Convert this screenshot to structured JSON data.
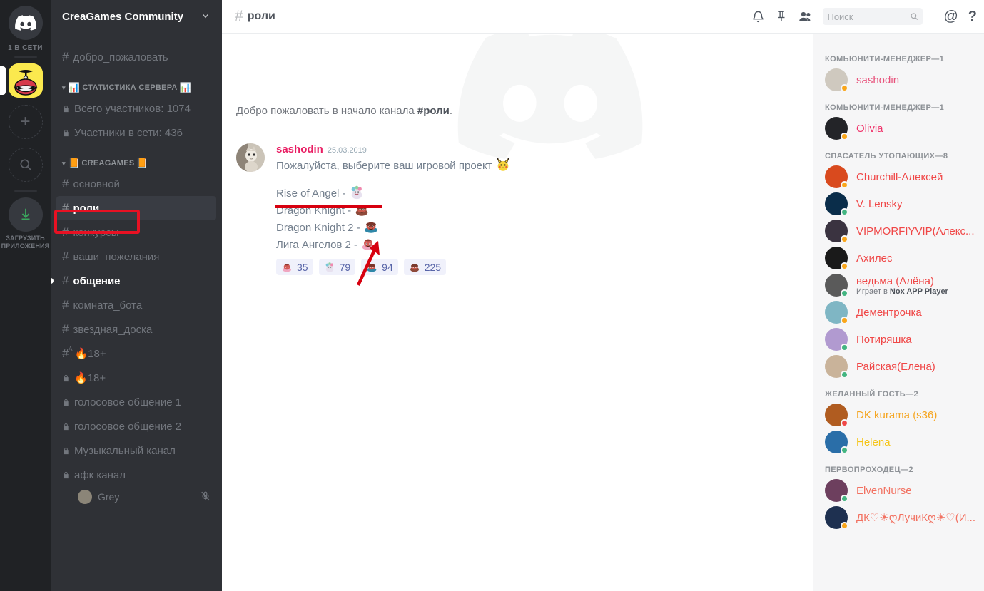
{
  "rail": {
    "online_count": "1 В СЕТИ",
    "server_name": "CreaGames",
    "add_server_label": "+",
    "explore_label": "search-icon",
    "download_label": "ЗАГРУЗИТЬ\nПРИЛОЖЕНИЯ",
    "download_line1": "ЗАГРУЗИТЬ",
    "download_line2": "ПРИЛОЖЕНИЯ"
  },
  "sidebar": {
    "guild_name": "CreaGames Community",
    "chevron": "⌄",
    "items": [
      {
        "type": "channel",
        "icon": "hash",
        "label": "добро_пожаловать",
        "state": "normal"
      },
      {
        "type": "category",
        "label": "📊 СТАТИСТИКА СЕРВЕРА 📊",
        "text": "СТАТИСТИКА СЕРВЕРА"
      },
      {
        "type": "channel",
        "icon": "lock",
        "label": "Всего участников: 1074",
        "state": "normal"
      },
      {
        "type": "channel",
        "icon": "lock",
        "label": "Участники в сети: 436",
        "state": "normal"
      },
      {
        "type": "category",
        "label": "📙CREAGAMES📙",
        "text": "CREAGAMES"
      },
      {
        "type": "channel",
        "icon": "hash",
        "label": "основной",
        "state": "normal"
      },
      {
        "type": "channel",
        "icon": "hash",
        "label": "роли",
        "state": "active"
      },
      {
        "type": "channel",
        "icon": "hash",
        "label": "конкурсы",
        "state": "normal"
      },
      {
        "type": "channel",
        "icon": "hash",
        "label": "ваши_пожелания",
        "state": "normal"
      },
      {
        "type": "channel",
        "icon": "hash",
        "label": "общение",
        "state": "unread"
      },
      {
        "type": "channel",
        "icon": "hash",
        "label": "комната_бота",
        "state": "normal"
      },
      {
        "type": "channel",
        "icon": "hash",
        "label": "звездная_доска",
        "state": "normal"
      },
      {
        "type": "channel",
        "icon": "hash-nsfw",
        "label": "🔥18+",
        "state": "normal"
      },
      {
        "type": "channel",
        "icon": "lock",
        "label": "🔥18+",
        "state": "normal"
      },
      {
        "type": "channel",
        "icon": "lock",
        "label": "голосовое общение 1",
        "state": "normal"
      },
      {
        "type": "channel",
        "icon": "lock",
        "label": "голосовое общение 2",
        "state": "normal"
      },
      {
        "type": "channel",
        "icon": "lock",
        "label": "Музыкальный канал",
        "state": "normal"
      },
      {
        "type": "channel",
        "icon": "lock",
        "label": "афк канал",
        "state": "normal"
      },
      {
        "type": "voice-user",
        "label": "Grey",
        "muted": true
      }
    ]
  },
  "topbar": {
    "hash": "#",
    "channel_name": "роли",
    "icons": [
      "bell-icon",
      "pin-icon",
      "members-icon",
      "mention-icon",
      "help-icon"
    ],
    "search_placeholder": "Поиск",
    "search_value": ""
  },
  "chat": {
    "welcome_prefix": "Добро пожаловать в начало канала ",
    "welcome_channel": "#роли",
    "welcome_suffix": ".",
    "message": {
      "author": "sashodin",
      "timestamp": "25.03.2019",
      "line1": "Пожалуйста, выберите ваш игровой проект ",
      "line1_emoji": "pikachu-emoji",
      "line2": "Rise of Angel - ",
      "line3": "Dragon Knight - ",
      "line4": "Dragon Knight 2 - ",
      "line5": "Лига Ангелов 2 - ",
      "reactions": [
        {
          "emoji": "liga-angelov-emoji",
          "count": "35"
        },
        {
          "emoji": "rise-of-angel-emoji",
          "count": "79"
        },
        {
          "emoji": "dragon-knight-2-emoji",
          "count": "94"
        },
        {
          "emoji": "dragon-knight-emoji",
          "count": "225"
        }
      ]
    }
  },
  "members": {
    "groups": [
      {
        "title": "КОМЬЮНИТИ-МЕНЕДЖЕР—1",
        "entries": [
          {
            "name": "sashodin",
            "color": "#e8537c",
            "status": "idle",
            "avatar": "#cfc9bf",
            "activity": ""
          }
        ]
      },
      {
        "title": "КОМЬЮНИТИ-МЕНЕДЖЕР—1",
        "entries": [
          {
            "name": "Olivia",
            "color": "#f0346b",
            "status": "idle",
            "avatar": "#232428",
            "activity": ""
          }
        ]
      },
      {
        "title": "СПАСАТЕЛЬ УТОПАЮЩИХ—8",
        "entries": [
          {
            "name": "Churchill-Алексей",
            "color": "#f04747",
            "status": "idle",
            "avatar": "#d94a1e",
            "activity": ""
          },
          {
            "name": "V. Lensky",
            "color": "#f04747",
            "status": "online",
            "avatar": "#0a2d4a",
            "activity": ""
          },
          {
            "name": "VIPMORFIYVIP(Алекс...",
            "color": "#f04747",
            "status": "idle",
            "avatar": "#3a3340",
            "activity": ""
          },
          {
            "name": "Ахилес",
            "color": "#f04747",
            "status": "idle",
            "avatar": "#1a1a1a",
            "activity": ""
          },
          {
            "name": "ведьма (Алёна)",
            "color": "#f04747",
            "status": "online",
            "avatar": "#5a5a5a",
            "activity_prefix": "Играет в ",
            "activity_app": "Nox APP Player"
          },
          {
            "name": "Дементрочка",
            "color": "#f04747",
            "status": "idle",
            "avatar": "#7fb6c4",
            "activity": ""
          },
          {
            "name": "Потиряшка",
            "color": "#f04747",
            "status": "online",
            "avatar": "#b19ad0",
            "activity": ""
          },
          {
            "name": "Райская(Елена)",
            "color": "#f04747",
            "status": "online",
            "avatar": "#c9b39a",
            "activity": ""
          }
        ]
      },
      {
        "title": "ЖЕЛАННЫЙ ГОСТЬ—2",
        "entries": [
          {
            "name": "DK kurama (s36)",
            "color": "#f5a623",
            "status": "dnd",
            "avatar": "#b05c20",
            "activity": ""
          },
          {
            "name": "Helena",
            "color": "#f5c518",
            "status": "online",
            "avatar": "#2a6ea8",
            "activity": ""
          }
        ]
      },
      {
        "title": "ПЕРВОПРОХОДЕЦ—2",
        "entries": [
          {
            "name": "ElvenNurse",
            "color": "#f27161",
            "status": "online",
            "avatar": "#6d3f5e",
            "activity": ""
          },
          {
            "name": "ДК♡☀︎︎ღЛучиКღ☀︎︎♡(И...",
            "color": "#f27161",
            "status": "idle",
            "avatar": "#1e3050",
            "activity": ""
          }
        ]
      }
    ]
  },
  "annotations": {
    "roles_box_label": "red-highlight-box-roles-channel",
    "underline_label": "red-underline-dragon-knight-2",
    "arrow_label": "red-arrow-pointing-to-reaction-94"
  },
  "colors": {
    "accent_red": "#e81123",
    "rail_bg": "#202225",
    "sidebar_bg": "#2f3136",
    "member_bg": "#f6f6f7",
    "link_blue": "#5865a8"
  }
}
